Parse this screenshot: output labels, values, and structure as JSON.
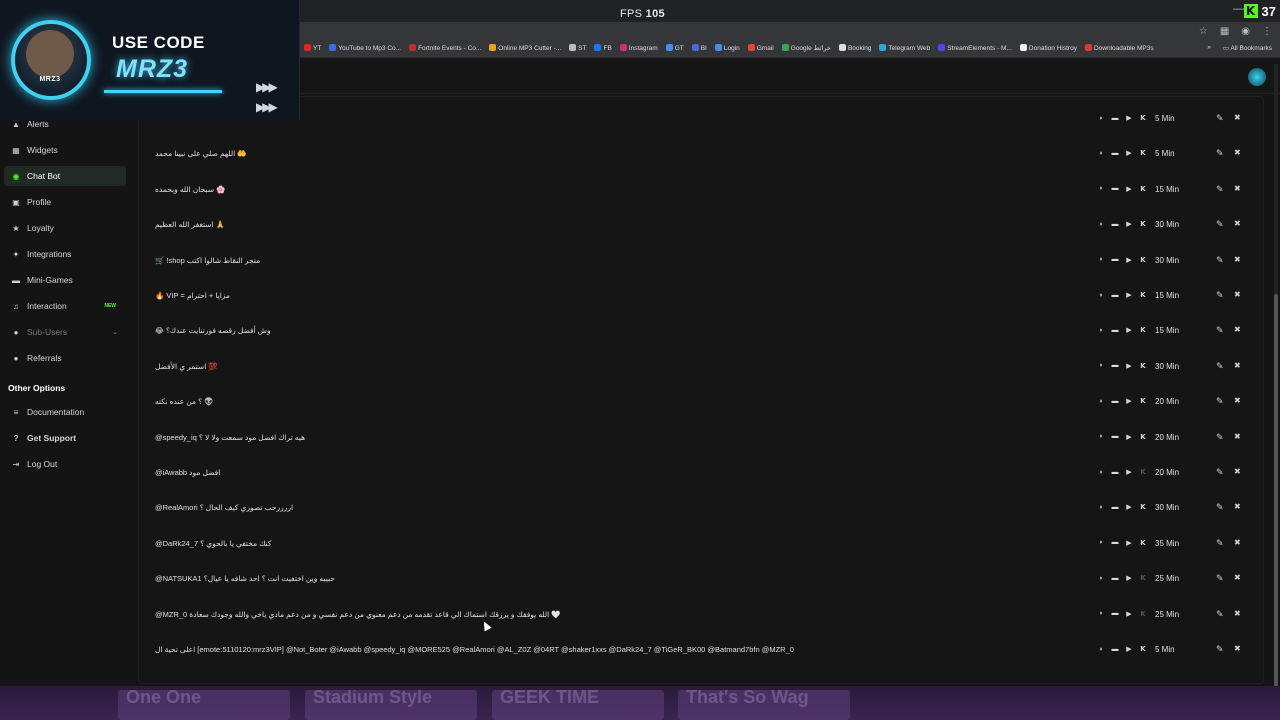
{
  "browser": {
    "fps_label": "FPS",
    "fps_value": "105",
    "kick_count": "37",
    "bookmarks": [
      {
        "label": "YT",
        "color": "#e02424"
      },
      {
        "label": "YouTube to Mp3 Co...",
        "color": "#3b6fd8"
      },
      {
        "label": "Fortnite Events - Co...",
        "color": "#bf2f2f"
      },
      {
        "label": "Online MP3 Cutter -...",
        "color": "#e8a320"
      },
      {
        "label": "ST",
        "color": "#bbbbbb"
      },
      {
        "label": "FB",
        "color": "#1877f2"
      },
      {
        "label": "Instagram",
        "color": "#d62976"
      },
      {
        "label": "GT",
        "color": "#4a8af4"
      },
      {
        "label": "BI",
        "color": "#4a6ad8"
      },
      {
        "label": "Login",
        "color": "#4a8af4"
      },
      {
        "label": "Gmail",
        "color": "#ea4335"
      },
      {
        "label": "Google خرائط",
        "color": "#34a853"
      },
      {
        "label": "Booking",
        "color": "#dddddd"
      },
      {
        "label": "Telegram Web",
        "color": "#2aa3df"
      },
      {
        "label": "StreamElements - M...",
        "color": "#4f46e5"
      },
      {
        "label": "Donation Histroy",
        "color": "#eeeeee"
      },
      {
        "label": "Downloadable MP3s",
        "color": "#d93a3a"
      }
    ],
    "all_bookmarks": "All Bookmarks"
  },
  "promo": {
    "use_text": "USE CODE",
    "code_text": "MRZ3",
    "logo_text": "MRZ3"
  },
  "sidebar": {
    "items": [
      {
        "label": "Alerts",
        "icon": "bell-icon",
        "glyph": "▲"
      },
      {
        "label": "Widgets",
        "icon": "widgets-icon",
        "glyph": "▦"
      },
      {
        "label": "Chat Bot",
        "icon": "bot-icon",
        "glyph": "◉"
      },
      {
        "label": "Profile",
        "icon": "profile-icon",
        "glyph": "▣"
      },
      {
        "label": "Loyalty",
        "icon": "trophy-icon",
        "glyph": "★"
      },
      {
        "label": "Integrations",
        "icon": "integrations-icon",
        "glyph": "✦"
      },
      {
        "label": "Mini-Games",
        "icon": "gamepad-icon",
        "glyph": "▬"
      },
      {
        "label": "Interaction",
        "icon": "music-icon",
        "glyph": "♫",
        "badge": "NEW"
      },
      {
        "label": "Sub-Users",
        "icon": "sub-users-icon",
        "glyph": "●"
      },
      {
        "label": "Referrals",
        "icon": "referrals-icon",
        "glyph": "●"
      }
    ],
    "other_title": "Other Options",
    "other_items": [
      {
        "label": "Documentation",
        "icon": "doc-icon",
        "glyph": "≡"
      },
      {
        "label": "Get Support",
        "icon": "help-icon",
        "glyph": "?"
      },
      {
        "label": "Log Out",
        "icon": "logout-icon",
        "glyph": "⇥"
      }
    ]
  },
  "timers": [
    {
      "message": "",
      "interval": "5 Min",
      "kick_active": true
    },
    {
      "message": "اللهم صلي على نبينا محمد 🤲",
      "interval": "5 Min",
      "kick_active": true
    },
    {
      "message": "سبحان الله وبحمده 🌸",
      "interval": "15 Min",
      "kick_active": true
    },
    {
      "message": "استغفر الله العظيم 🙏",
      "interval": "30 Min",
      "kick_active": true
    },
    {
      "message": "🛒 !shop متجر النقاط شالوا اكتب",
      "interval": "30 Min",
      "kick_active": true
    },
    {
      "message": "🔥 VIP = مزايا + احترام",
      "interval": "15 Min",
      "kick_active": true
    },
    {
      "message": "😂 وش أفضل رقصه فورتنايت عندك؟",
      "interval": "15 Min",
      "kick_active": true
    },
    {
      "message": "استمر ي الأفضل 💯",
      "interval": "30 Min",
      "kick_active": true
    },
    {
      "message": "؟ من عنده نكته 👽",
      "interval": "20 Min",
      "kick_active": true
    },
    {
      "message": "@speedy_iq هيه تراك افضل مود سمعت ولا لا ؟",
      "interval": "20 Min",
      "kick_active": true
    },
    {
      "message": "@iAwabb افضل مود",
      "interval": "20 Min",
      "kick_active": false
    },
    {
      "message": "@RealAmori اررررحب تصوري كيف الحال ؟",
      "interval": "30 Min",
      "kick_active": true
    },
    {
      "message": "@DaRk24_7 كنك مختفي يا بالحوي ؟",
      "interval": "35 Min",
      "kick_active": true
    },
    {
      "message": "@NATSUKA1 حبيبه وين اختفيت انت ؟ احد شافه يا عيال؟",
      "interval": "25 Min",
      "kick_active": false
    },
    {
      "message": "@MZR_0 الله يوفقك و يرزقك استماك الي قاعد تقدمه من دعم معنوي من دعم نفسي و من دعم مادي ياخي والله وجودك سعادة 🤍",
      "interval": "25 Min",
      "kick_active": false
    },
    {
      "message": "اعلى تحية ال [emote:5110120:mrz3VIP] @Not_Boter @iAwabb @speedy_iq @MORE525 @RealAmori @AL_Z0Z @04RT @shaker1xxs @DaRk24_7 @TiGeR_BK00 @Batmand7bfn @MZR_0",
      "interval": "5 Min",
      "kick_active": true
    }
  ],
  "bottom_cards": [
    "One One",
    "Stadium Style",
    "GEEK TIME",
    "That's So Wag"
  ]
}
